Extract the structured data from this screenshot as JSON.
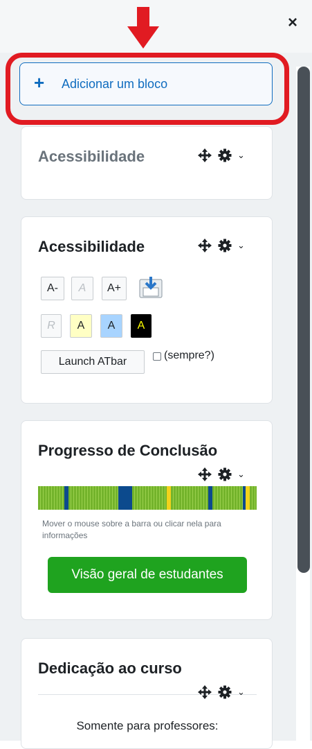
{
  "header": {
    "close_symbol": "×"
  },
  "add_block": {
    "icon": "+",
    "label": "Adicionar um bloco"
  },
  "blocks": [
    {
      "title": "Acessibilidade"
    },
    {
      "title": "Acessibilidade",
      "font_buttons": [
        "A-",
        "A",
        "A+"
      ],
      "color_buttons": [
        "R",
        "A",
        "A",
        "A"
      ],
      "launch_label": "Launch ATbar",
      "always_label": "(sempre?)"
    },
    {
      "title": "Progresso de Conclusão",
      "info": "Mover o mouse sobre a barra ou clicar nela para informações",
      "button_label": "Visão geral de estudantes"
    },
    {
      "title": "Dedicação ao curso",
      "teachers_only": "Somente para professores:"
    }
  ],
  "colors": {
    "accent": "#0f6cbf",
    "highlight": "#e11b22",
    "complete": "#73b32b",
    "incomplete": "#0c4a8d",
    "submitted": "#f3d21c",
    "button_green": "#1fa31f"
  }
}
